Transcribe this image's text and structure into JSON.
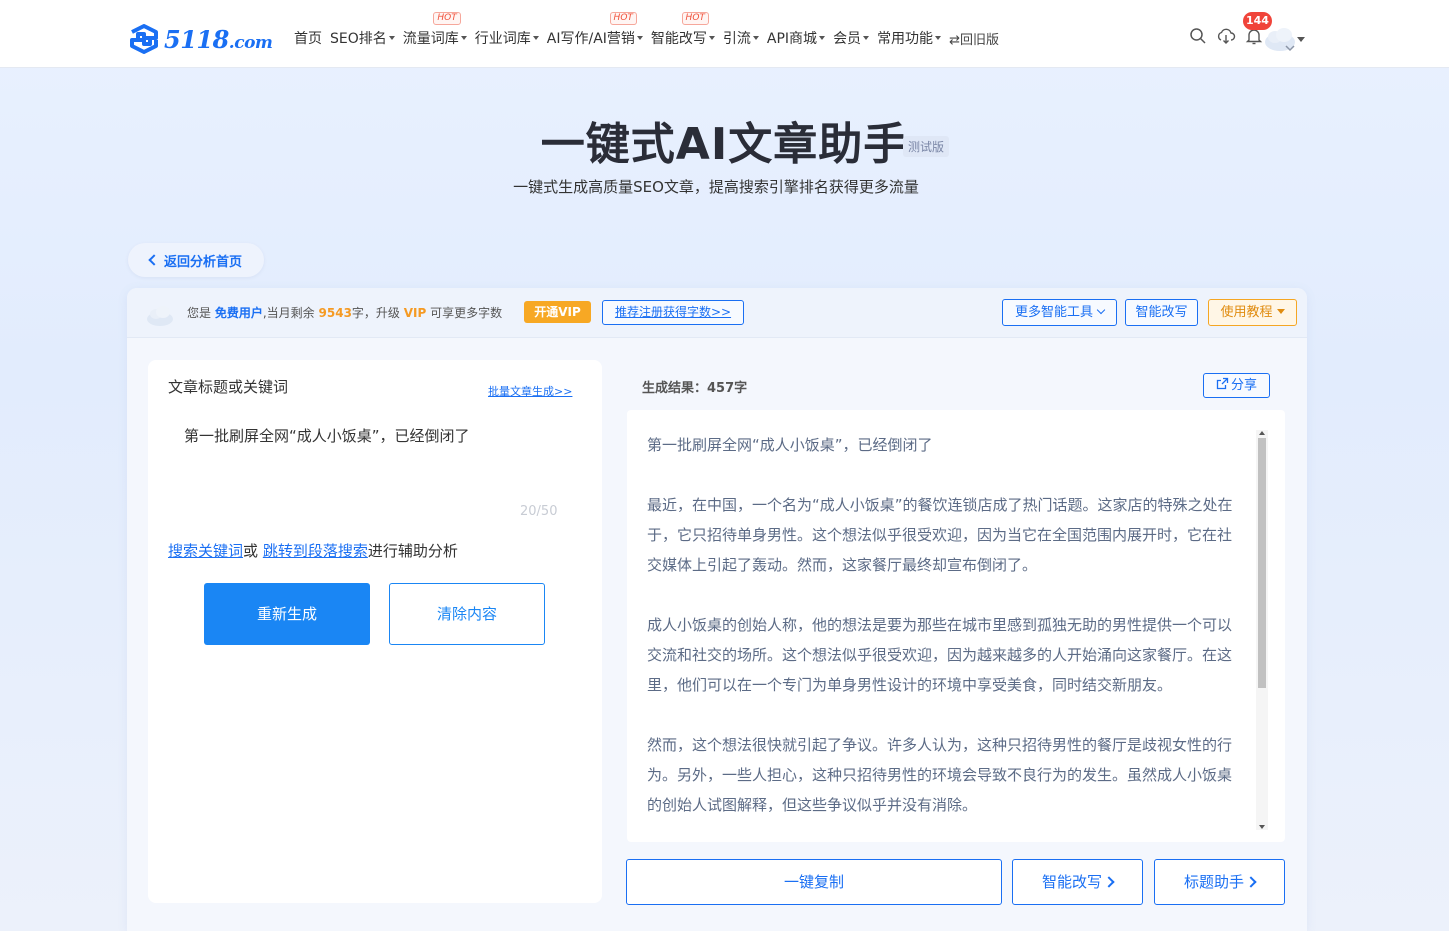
{
  "nav": {
    "logo_text": "5118",
    "logo_suffix": ".com",
    "items": [
      {
        "label": "首页",
        "caret": false,
        "hot": false
      },
      {
        "label": "SEO排名",
        "caret": true,
        "hot": false
      },
      {
        "label": "流量词库",
        "caret": true,
        "hot": true
      },
      {
        "label": "行业词库",
        "caret": true,
        "hot": false
      },
      {
        "label": "AI写作/AI营销",
        "caret": true,
        "hot": true
      },
      {
        "label": "智能改写",
        "caret": true,
        "hot": true
      },
      {
        "label": "引流",
        "caret": true,
        "hot": false
      },
      {
        "label": "API商城",
        "caret": true,
        "hot": false
      },
      {
        "label": "会员",
        "caret": true,
        "hot": false
      },
      {
        "label": "常用功能",
        "caret": true,
        "hot": false
      }
    ],
    "hot_label": "HOT",
    "old_version": "⇄回旧版",
    "notification_count": "144",
    "icons": [
      "search-icon",
      "cloud-download-icon",
      "bell-icon"
    ]
  },
  "hero": {
    "title": "一键式AI文章助手",
    "beta_tag": "测试版",
    "subtitle": "一键式生成高质量SEO文章，提高搜索引擎排名获得更多流量"
  },
  "back_button": "返回分析首页",
  "infobar": {
    "prefix": "您是",
    "user_type": "免费用户",
    "mid1": ",当月剩余",
    "remaining": "9543",
    "mid2": "字，升级",
    "vip": "VIP",
    "suffix": "可享更多字数",
    "vip_button": "开通VIP",
    "invite_button": "推荐注册获得字数>>",
    "more_tools": "更多智能工具",
    "smart_rewrite": "智能改写",
    "tutorial": "使用教程"
  },
  "left": {
    "label": "文章标题或关键词",
    "batch_link": "批量文章生成>>",
    "input_value": "第一批刷屏全网“成人小饭桌”，已经倒闭了",
    "counter": "20/50",
    "assist_link1": "搜索关键词",
    "assist_mid": "或",
    "assist_link2": "跳转到段落搜索",
    "assist_suffix": "进行辅助分析",
    "regen_button": "重新生成",
    "clear_button": "清除内容"
  },
  "right": {
    "result_label": "生成结果：457字",
    "share_button": "分享",
    "paragraphs": [
      "第一批刷屏全网“成人小饭桌”，已经倒闭了",
      "最近，在中国，一个名为“成人小饭桌”的餐饮连锁店成了热门话题。这家店的特殊之处在于，它只招待单身男性。这个想法似乎很受欢迎，因为当它在全国范围内展开时，它在社交媒体上引起了轰动。然而，这家餐厅最终却宣布倒闭了。",
      "成人小饭桌的创始人称，他的想法是要为那些在城市里感到孤独无助的男性提供一个可以交流和社交的场所。这个想法似乎很受欢迎，因为越来越多的人开始涌向这家餐厅。在这里，他们可以在一个专门为单身男性设计的环境中享受美食，同时结交新朋友。",
      "然而，这个想法很快就引起了争议。许多人认为，这种只招待男性的餐厅是歧视女性的行为。另外，一些人担心，这种只招待男性的环境会导致不良行为的发生。虽然成人小饭桌的创始人试图解释，但这些争议似乎并没有消除。"
    ],
    "copy_button": "一键复制",
    "rewrite_button": "智能改写",
    "title_helper_button": "标题助手"
  },
  "colors": {
    "primary": "#1a6ff3",
    "button_blue": "#1a86f4",
    "orange": "#f7a824",
    "badge_red": "#f0443a",
    "hot_red": "#f0533d"
  }
}
